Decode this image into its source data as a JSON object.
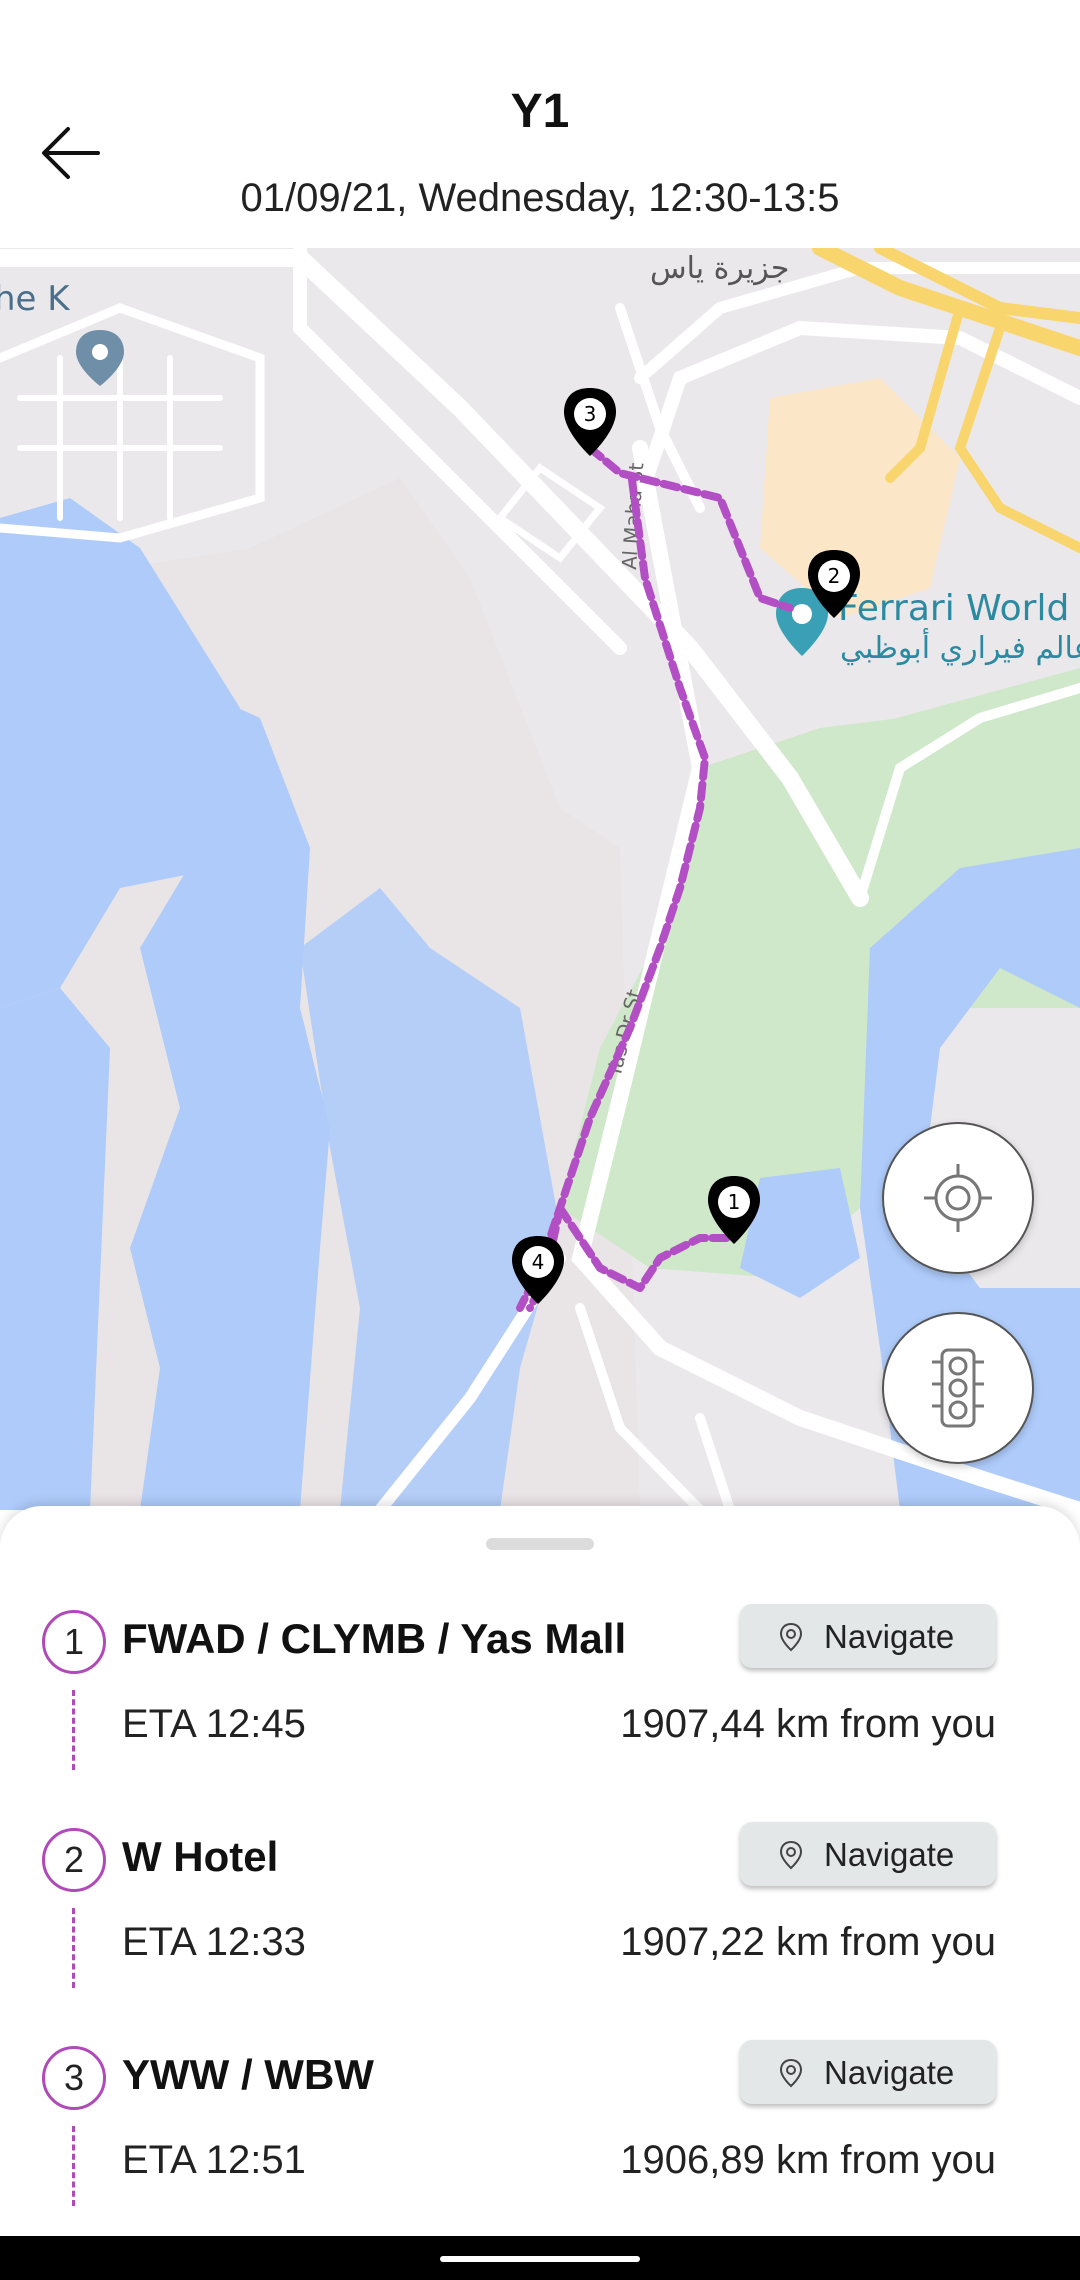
{
  "header": {
    "title": "Y1",
    "subtitle": "01/09/21, Wednesday, 12:30-13:5"
  },
  "map": {
    "labels": {
      "island_arabic": "جزيرة ياس",
      "poi_partial": "he K",
      "ferrari_en": "Ferrari World A",
      "ferrari_ar": "عالم فيراري أبوظبي",
      "street_1": "Al Maha St",
      "street_2": "Yas Dr St"
    },
    "markers": [
      "1",
      "2",
      "3",
      "4"
    ],
    "route_color": "#b34fc4"
  },
  "controls": {
    "locate_icon": "crosshair-icon",
    "traffic_icon": "traffic-light-icon"
  },
  "stops": [
    {
      "number": "1",
      "name": "FWAD / CLYMB / Yas Mall",
      "navigate_label": "Navigate",
      "eta": "ETA 12:45",
      "distance": "1907,44 km from you"
    },
    {
      "number": "2",
      "name": "W Hotel",
      "navigate_label": "Navigate",
      "eta": "ETA 12:33",
      "distance": "1907,22 km from you"
    },
    {
      "number": "3",
      "name": "YWW / WBW",
      "navigate_label": "Navigate",
      "eta": "ETA 12:51",
      "distance": "1906,89 km from you"
    }
  ],
  "colors": {
    "accent": "#b04ab8",
    "water": "#aecbfa",
    "park": "#c8e6c9"
  }
}
